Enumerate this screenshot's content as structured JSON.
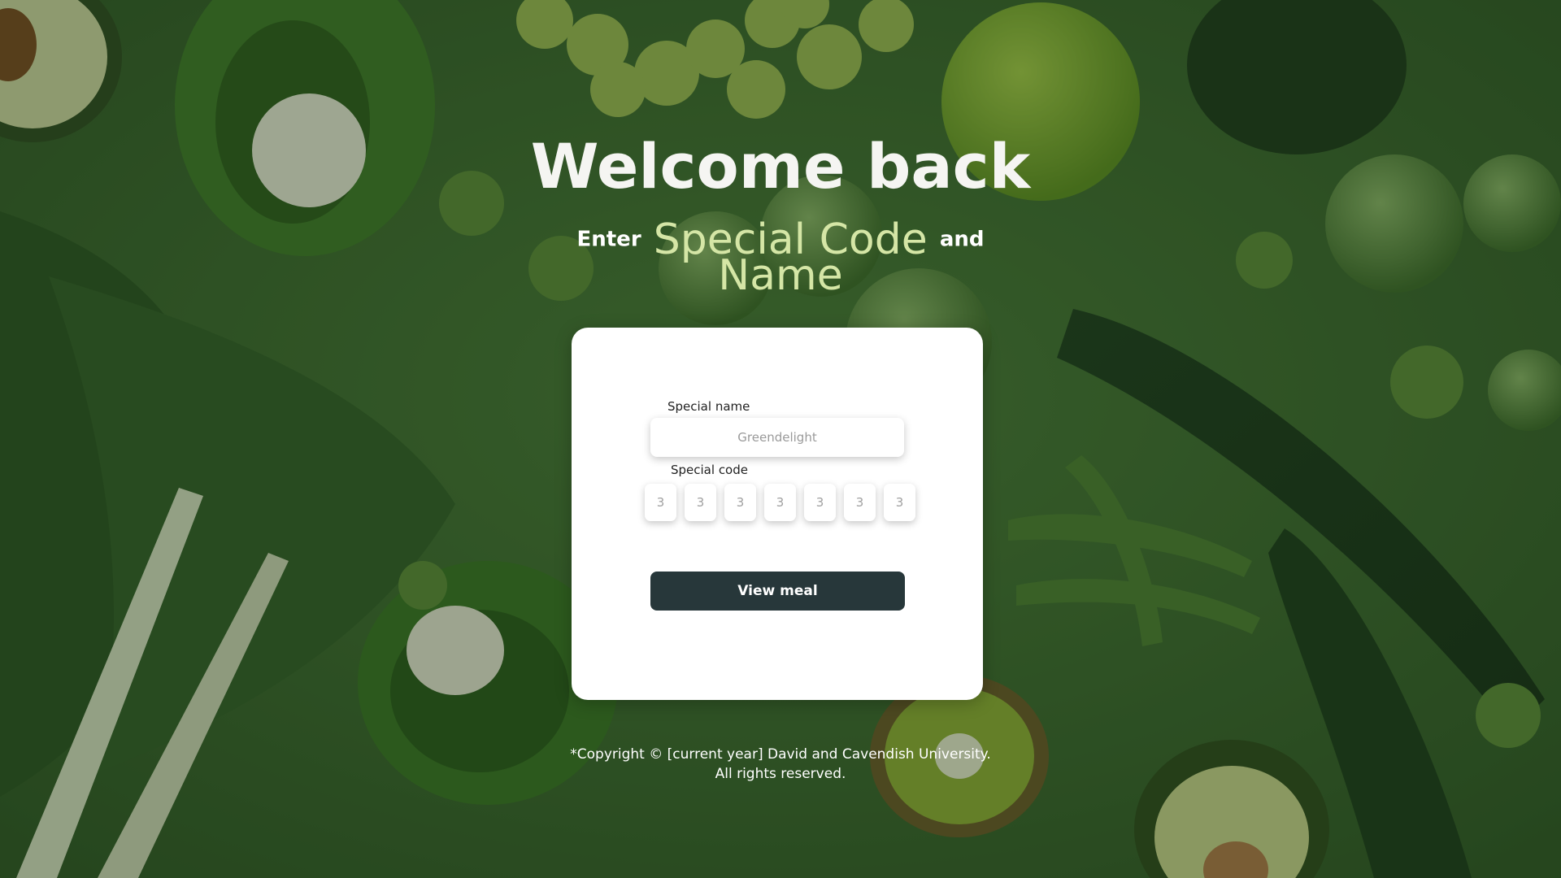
{
  "header": {
    "title": "Welcome back",
    "subtitle_part1": "Enter",
    "subtitle_highlight1": "Special Code",
    "subtitle_part2": "and",
    "subtitle_highlight2": "Name"
  },
  "form": {
    "name_label": "Special name",
    "name_placeholder": "Greendelight",
    "name_value": "",
    "code_label": "Special code",
    "code_digits": [
      "3",
      "3",
      "3",
      "3",
      "3",
      "3",
      "3"
    ],
    "submit_label": "View meal"
  },
  "footer": {
    "line1": "*Copyright © [current year] David and Cavendish University.",
    "line2": "All rights reserved."
  },
  "colors": {
    "background": "#3f6a32",
    "title": "#f5f5f2",
    "highlight": "#d5e6a6",
    "card": "#ffffff",
    "button": "#27373a"
  }
}
